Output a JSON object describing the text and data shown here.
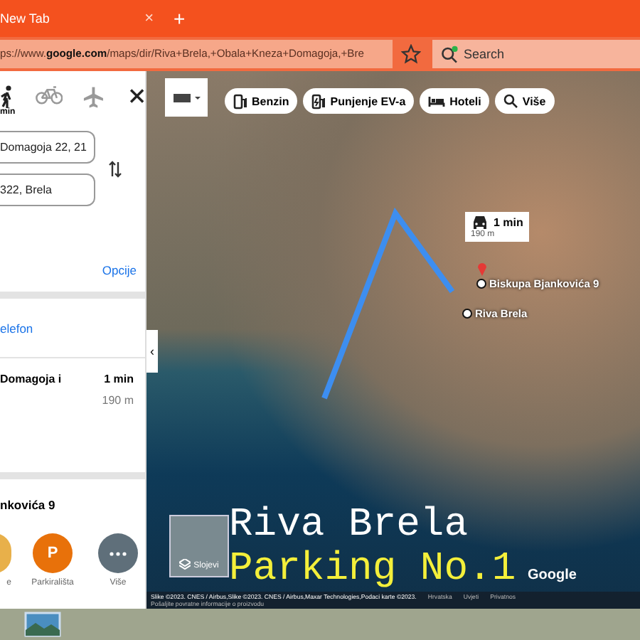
{
  "browser": {
    "tab": {
      "title": "New Tab",
      "close": "×"
    },
    "new_tab": "+",
    "url": "ps://www.**google.com**/maps/dir/Riva+Brela,+Obala+Kneza+Domagoja,+Bre",
    "search": {
      "placeholder": "Search"
    }
  },
  "directions": {
    "modes": [
      {
        "kind": "walk",
        "label": "min"
      },
      {
        "kind": "bike"
      },
      {
        "kind": "plane"
      }
    ],
    "origin": "Domagoja 22, 21",
    "destination": "322, Brela",
    "options_link": "Opcije",
    "phone_link": "elefon",
    "route": {
      "name": "Domagoja i",
      "time": "1 min",
      "distance": "190 m"
    },
    "place_title": "nkovića 9",
    "actions": [
      {
        "kind": "partial",
        "label": "e"
      },
      {
        "kind": "parking",
        "icon": "P",
        "label": "Parkirališta"
      },
      {
        "kind": "more",
        "label": "Više"
      }
    ]
  },
  "map": {
    "chips": [
      {
        "kind": "fuel",
        "label": "Benzin"
      },
      {
        "kind": "ev",
        "label": "Punjenje EV-a"
      },
      {
        "kind": "hotel",
        "label": "Hoteli"
      },
      {
        "kind": "search",
        "label": "Više"
      }
    ],
    "route_callout": {
      "time": "1 min",
      "distance": "190 m"
    },
    "places": [
      {
        "kind": "destination",
        "label": "Biskupa Bjankovića 9"
      },
      {
        "kind": "origin",
        "label": "Riva Brela"
      }
    ],
    "collapse": "‹",
    "layers": "Slojevi",
    "logo": "Google",
    "attribution": "Slike ©2023. CNES / Airbus,Slike ©2023. CNES / Airbus,Maxar Technologies,Podaci karte ©2023.",
    "links": [
      "Hrvatska",
      "Uvjeti",
      "Privatnos"
    ],
    "feedback": "Pošaljite povratne informacije o proizvodu"
  },
  "caption": [
    "Riva Brela",
    "Parking No.1"
  ]
}
